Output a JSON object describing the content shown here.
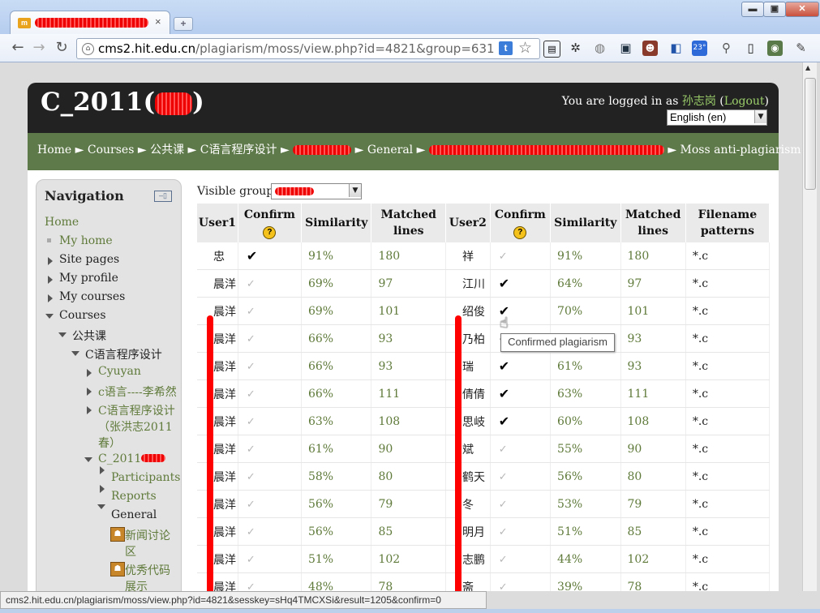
{
  "browser": {
    "tab": {
      "favicon": "m",
      "close": "×"
    },
    "new_tab": "+",
    "window": {
      "minimize": "▬",
      "maximize": "▣",
      "close": "✕"
    },
    "url_prefix": "cms2.hit.edu.cn",
    "url_rest": "/plagiarism/moss/view.php?id=4821&group=631",
    "ext_badge": "23°"
  },
  "header": {
    "site_title": "C_2011(",
    "site_title_end": ")",
    "login_prefix": "You are logged in as ",
    "user_name": "孙志岗",
    "logout": "Logout",
    "language": "English (en)"
  },
  "breadcrumb": {
    "items": [
      "Home",
      "Courses",
      "公共课",
      "C语言程序设计",
      "General",
      "Moss anti-plagiarism"
    ],
    "sep": "►"
  },
  "navigation": {
    "title": "Navigation",
    "items": [
      {
        "label": "Home"
      },
      {
        "label": "My home"
      },
      {
        "label": "Site pages"
      },
      {
        "label": "My profile"
      },
      {
        "label": "My courses"
      },
      {
        "label": "Courses"
      },
      {
        "label": "公共课"
      },
      {
        "label": "C语言程序设计"
      },
      {
        "label": "Cyuyan"
      },
      {
        "label": "c语言----李希然"
      },
      {
        "label": "C语言程序设计"
      },
      {
        "label": "（张洪志2011"
      },
      {
        "label": "春）"
      },
      {
        "label": "C_2011"
      },
      {
        "label": "Participants"
      },
      {
        "label": "Reports"
      },
      {
        "label": "General"
      },
      {
        "label": "新闻讨论"
      },
      {
        "label": "区"
      },
      {
        "label": "优秀代码"
      },
      {
        "label": "展示"
      }
    ]
  },
  "groups": {
    "label": "Visible groups"
  },
  "table": {
    "headers": {
      "user1": "User1",
      "confirm1": "Confirm",
      "similarity1": "Similarity",
      "matched1a": "Matched",
      "matched1b": "lines",
      "user2": "User2",
      "confirm2": "Confirm",
      "similarity2": "Similarity",
      "matched2a": "Matched",
      "matched2b": "lines",
      "filename_a": "Filename",
      "filename_b": "patterns"
    },
    "help_glyph": "?",
    "rows": [
      {
        "user1": "忠",
        "confirm1": "✔",
        "sim1": "91%",
        "lines1": "180",
        "user2": "祥",
        "confirm2": "✓",
        "sim2": "91%",
        "lines2": "180",
        "pattern": "*.c"
      },
      {
        "user1": "晨洋",
        "confirm1": "✓",
        "sim1": "69%",
        "lines1": "97",
        "user2": "江川",
        "confirm2": "✔",
        "sim2": "64%",
        "lines2": "97",
        "pattern": "*.c"
      },
      {
        "user1": "晨洋",
        "confirm1": "✓",
        "sim1": "69%",
        "lines1": "101",
        "user2": "绍俊",
        "confirm2": "✔",
        "sim2": "70%",
        "lines2": "101",
        "pattern": "*.c"
      },
      {
        "user1": "晨洋",
        "confirm1": "✓",
        "sim1": "66%",
        "lines1": "93",
        "user2": "乃柏",
        "confirm2": "✔",
        "sim2": "",
        "lines2": "93",
        "pattern": "*.c"
      },
      {
        "user1": "晨洋",
        "confirm1": "✓",
        "sim1": "66%",
        "lines1": "93",
        "user2": "瑞",
        "confirm2": "✔",
        "sim2": "61%",
        "lines2": "93",
        "pattern": "*.c"
      },
      {
        "user1": "晨洋",
        "confirm1": "✓",
        "sim1": "66%",
        "lines1": "111",
        "user2": "倩倩",
        "confirm2": "✔",
        "sim2": "63%",
        "lines2": "111",
        "pattern": "*.c"
      },
      {
        "user1": "晨洋",
        "confirm1": "✓",
        "sim1": "63%",
        "lines1": "108",
        "user2": "思岐",
        "confirm2": "✔",
        "sim2": "60%",
        "lines2": "108",
        "pattern": "*.c"
      },
      {
        "user1": "晨洋",
        "confirm1": "✓",
        "sim1": "61%",
        "lines1": "90",
        "user2": "斌",
        "confirm2": "✓",
        "sim2": "55%",
        "lines2": "90",
        "pattern": "*.c"
      },
      {
        "user1": "晨洋",
        "confirm1": "✓",
        "sim1": "58%",
        "lines1": "80",
        "user2": "鹤天",
        "confirm2": "✓",
        "sim2": "56%",
        "lines2": "80",
        "pattern": "*.c"
      },
      {
        "user1": "晨洋",
        "confirm1": "✓",
        "sim1": "56%",
        "lines1": "79",
        "user2": "冬",
        "confirm2": "✓",
        "sim2": "53%",
        "lines2": "79",
        "pattern": "*.c"
      },
      {
        "user1": "晨洋",
        "confirm1": "✓",
        "sim1": "56%",
        "lines1": "85",
        "user2": "明月",
        "confirm2": "✓",
        "sim2": "51%",
        "lines2": "85",
        "pattern": "*.c"
      },
      {
        "user1": "晨洋",
        "confirm1": "✓",
        "sim1": "51%",
        "lines1": "102",
        "user2": "志鹏",
        "confirm2": "✓",
        "sim2": "44%",
        "lines2": "102",
        "pattern": "*.c"
      },
      {
        "user1": "晨洋",
        "confirm1": "✓",
        "sim1": "48%",
        "lines1": "78",
        "user2": "斋",
        "confirm2": "✓",
        "sim2": "39%",
        "lines2": "78",
        "pattern": "*.c"
      }
    ]
  },
  "tooltip": "Confirmed plagiarism",
  "status_bar": "cms2.hit.edu.cn/plagiarism/moss/view.php?id=4821&sesskey=sHq4TMCXSi&result=1205&confirm=0"
}
